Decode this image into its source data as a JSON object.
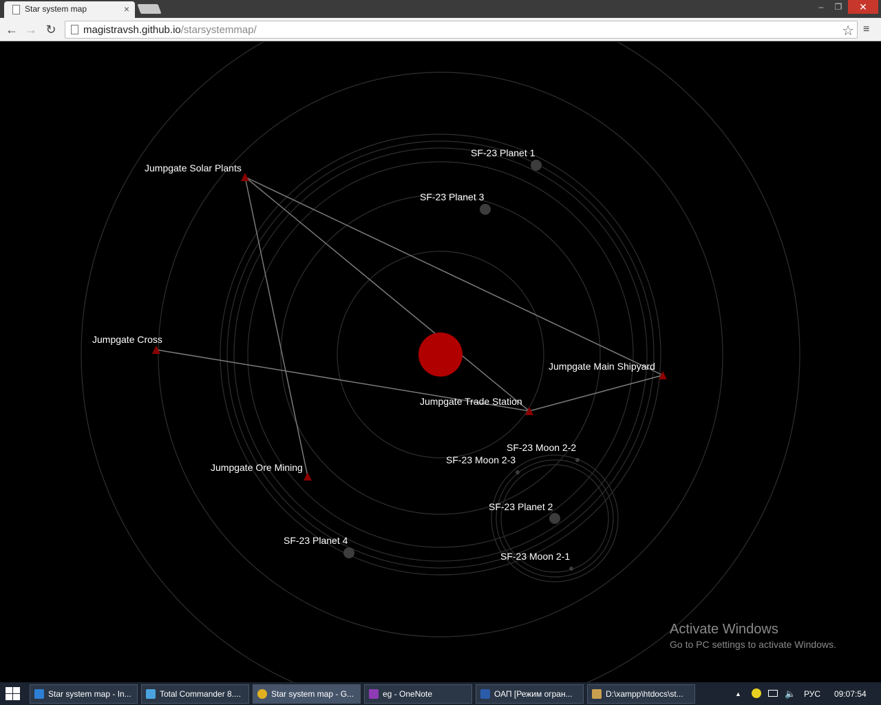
{
  "browser": {
    "tab_title": "Star system map",
    "tab_close": "×",
    "url_host": "magistravsh.github.io",
    "url_path": "/starsystemmap/",
    "window_min": "–",
    "window_max": "❐",
    "window_close": "✕",
    "back": "←",
    "forward": "→",
    "reload": "↻",
    "star": "☆",
    "menu": "≡"
  },
  "map": {
    "background": "#000000",
    "star_color": "#b00000",
    "gate_color": "#8b0000",
    "orbit_color": "#2f2f2f",
    "route_color": "#7a7a7a",
    "body_color": "#3c3c3c",
    "labels": {
      "planet1": "SF-23 Planet 1",
      "planet2": "SF-23 Planet 2",
      "planet3": "SF-23 Planet 3",
      "planet4": "SF-23 Planet 4",
      "moon21": "SF-23 Moon 2-1",
      "moon22": "SF-23 Moon 2-2",
      "moon23": "SF-23 Moon 2-3",
      "gate_solar": "Jumpgate Solar Plants",
      "gate_cross": "Jumpgate Cross",
      "gate_shipyard": "Jumpgate Main Shipyard",
      "gate_trade": "Jumpgate Trade Station",
      "gate_ore": "Jumpgate Ore Mining"
    }
  },
  "watermark": {
    "title": "Activate Windows",
    "subtitle": "Go to PC settings to activate Windows."
  },
  "taskbar": {
    "items": [
      {
        "label": "Star system map - In...",
        "color": "#2d7fd6"
      },
      {
        "label": "Total Commander 8....",
        "color": "#4aa3df"
      },
      {
        "label": "Star system map - G...",
        "color": "#e0b020"
      },
      {
        "label": "eg - OneNote",
        "color": "#8e3bb5"
      },
      {
        "label": "ОАП [Режим огран...",
        "color": "#2a5caa"
      },
      {
        "label": "D:\\xampp\\htdocs\\st...",
        "color": "#c8a050"
      }
    ],
    "tray_arrow": "▲",
    "lang": "РУС",
    "clock": "09:07:54"
  }
}
